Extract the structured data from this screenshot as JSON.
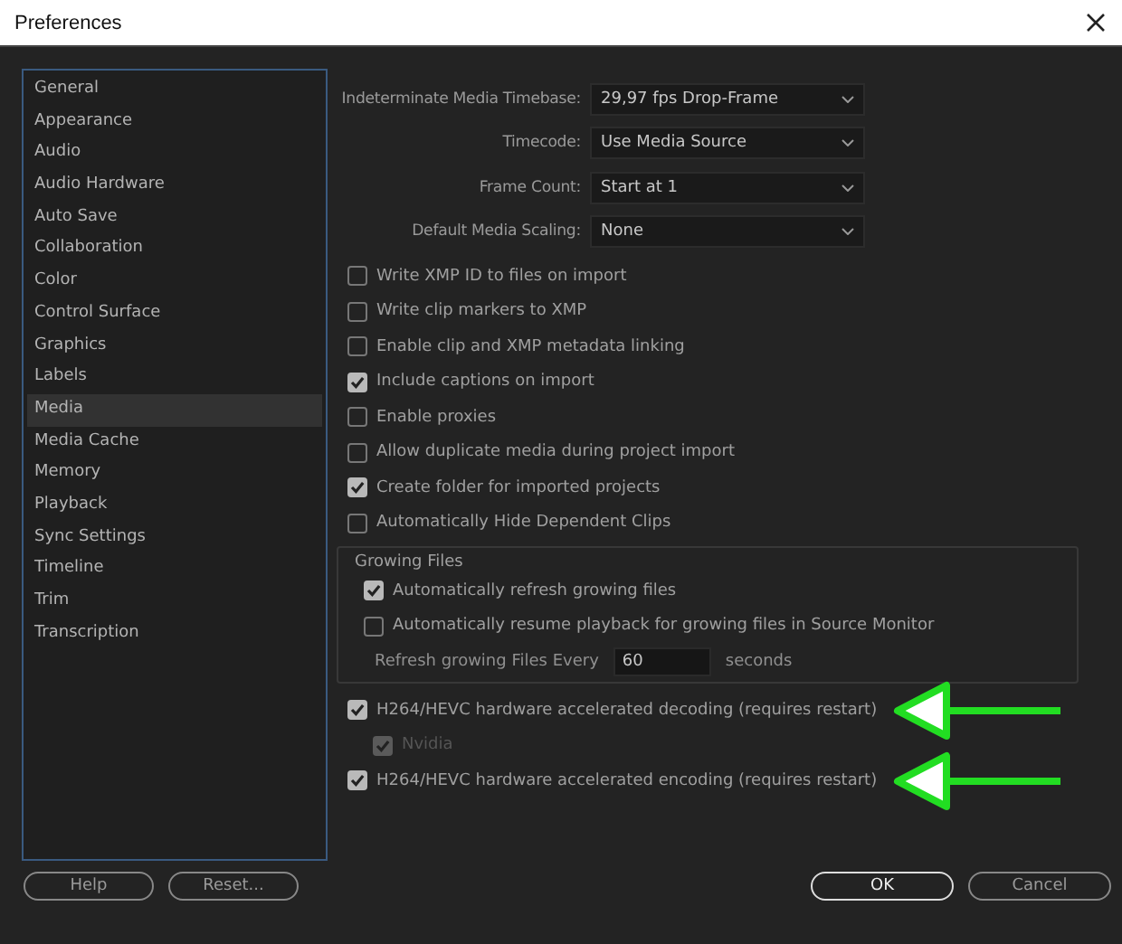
{
  "window": {
    "title": "Preferences"
  },
  "sidebar": {
    "items": [
      {
        "label": "General",
        "selected": false
      },
      {
        "label": "Appearance",
        "selected": false
      },
      {
        "label": "Audio",
        "selected": false
      },
      {
        "label": "Audio Hardware",
        "selected": false
      },
      {
        "label": "Auto Save",
        "selected": false
      },
      {
        "label": "Collaboration",
        "selected": false
      },
      {
        "label": "Color",
        "selected": false
      },
      {
        "label": "Control Surface",
        "selected": false
      },
      {
        "label": "Graphics",
        "selected": false
      },
      {
        "label": "Labels",
        "selected": false
      },
      {
        "label": "Media",
        "selected": true
      },
      {
        "label": "Media Cache",
        "selected": false
      },
      {
        "label": "Memory",
        "selected": false
      },
      {
        "label": "Playback",
        "selected": false
      },
      {
        "label": "Sync Settings",
        "selected": false
      },
      {
        "label": "Timeline",
        "selected": false
      },
      {
        "label": "Trim",
        "selected": false
      },
      {
        "label": "Transcription",
        "selected": false
      }
    ]
  },
  "dropdowns": [
    {
      "label": "Indeterminate Media Timebase:",
      "value": "29,97 fps Drop-Frame"
    },
    {
      "label": "Timecode:",
      "value": "Use Media Source"
    },
    {
      "label": "Frame Count:",
      "value": "Start at 1"
    },
    {
      "label": "Default Media Scaling:",
      "value": "None"
    }
  ],
  "checkboxes": [
    {
      "label": "Write XMP ID to files on import",
      "checked": false
    },
    {
      "label": "Write clip markers to XMP",
      "checked": false
    },
    {
      "label": "Enable clip and XMP metadata linking",
      "checked": false
    },
    {
      "label": "Include captions on import",
      "checked": true
    },
    {
      "label": "Enable proxies",
      "checked": false
    },
    {
      "label": "Allow duplicate media during project import",
      "checked": false
    },
    {
      "label": "Create folder for imported projects",
      "checked": true
    },
    {
      "label": "Automatically Hide Dependent Clips",
      "checked": false
    }
  ],
  "growing_files": {
    "title": "Growing Files",
    "checkboxes": [
      {
        "label": "Automatically refresh growing files",
        "checked": true
      },
      {
        "label": "Automatically resume playback for growing files in Source Monitor",
        "checked": false
      }
    ],
    "refresh": {
      "label": "Refresh growing Files Every",
      "value": "60",
      "unit": "seconds"
    }
  },
  "hardware": [
    {
      "label": "H264/HEVC hardware accelerated decoding (requires restart)",
      "checked": true,
      "disabled": false,
      "highlighted": true,
      "children": [
        {
          "label": "Nvidia",
          "checked": true,
          "disabled": true
        }
      ]
    },
    {
      "label": "H264/HEVC hardware accelerated encoding (requires restart)",
      "checked": true,
      "disabled": false,
      "highlighted": true
    }
  ],
  "buttons_left": [
    {
      "label": "Help",
      "default": false
    },
    {
      "label": "Reset...",
      "default": false
    }
  ],
  "buttons_right": [
    {
      "label": "OK",
      "default": true
    },
    {
      "label": "Cancel",
      "default": false
    }
  ]
}
